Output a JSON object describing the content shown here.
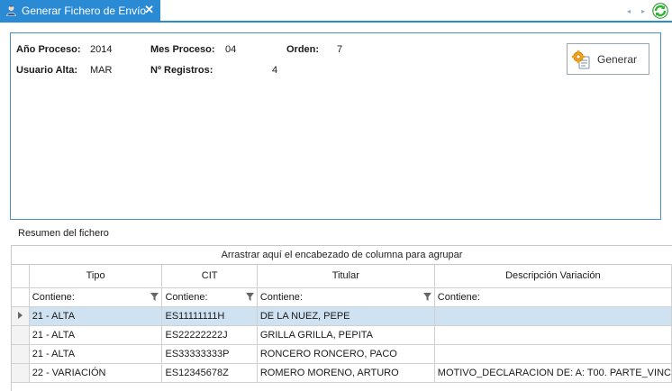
{
  "tab": {
    "title": "Generar Fichero de Envío",
    "close_glyph": "✕"
  },
  "icons": {
    "tab_icon": "app-user-icon",
    "refresh": "refresh-icon",
    "generar": "gear-document-icon",
    "filter": "filter-funnel-icon"
  },
  "colors": {
    "accent": "#2a8ad4",
    "panel_border": "#4a8ed0",
    "selected_row": "#cfe2f1",
    "refresh_green": "#2db52d"
  },
  "params": {
    "anio_label": "Año Proceso:",
    "anio_value": "2014",
    "mes_label": "Mes Proceso:",
    "mes_value": "04",
    "orden_label": "Orden:",
    "orden_value": "7",
    "usuario_label": "Usuario Alta:",
    "usuario_value": "MAR",
    "registros_label": "Nº Registros:",
    "registros_value": "4"
  },
  "generar": {
    "label": "Generar"
  },
  "summary": {
    "title": "Resumen del fichero"
  },
  "grid": {
    "group_panel_text": "Arrastrar aquí el encabezado de columna para agrupar",
    "columns": [
      "Tipo",
      "CIT",
      "Titular",
      "Descripción Variación"
    ],
    "filter_text": "Contiene:",
    "rows": [
      {
        "tipo": "21 - ALTA",
        "cit": "ES11111111H",
        "titular": "DE LA NUEZ, PEPE",
        "desc": ""
      },
      {
        "tipo": "21 - ALTA",
        "cit": "ES22222222J",
        "titular": "GRILLA GRILLA, PEPITA",
        "desc": ""
      },
      {
        "tipo": "21 - ALTA",
        "cit": "ES33333333P",
        "titular": "RONCERO RONCERO, PACO",
        "desc": ""
      },
      {
        "tipo": "22 - VARIACIÓN",
        "cit": "ES12345678Z",
        "titular": "ROMERO MORENO, ARTURO",
        "desc": "MOTIVO_DECLARACION DE: A: T00. PARTE_VINC"
      }
    ]
  }
}
